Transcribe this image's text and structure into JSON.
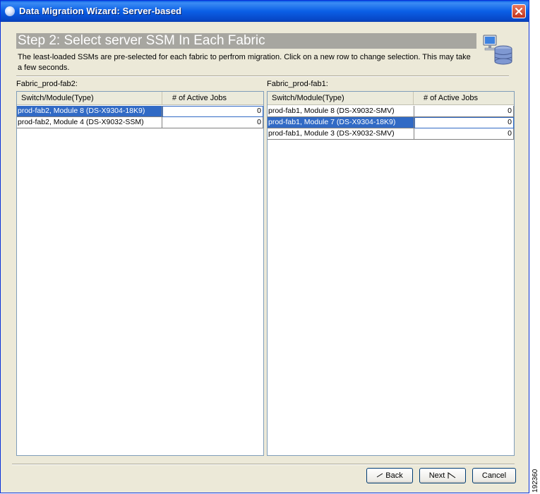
{
  "window": {
    "title": "Data Migration Wizard: Server-based"
  },
  "header": {
    "step_title": "Step 2: Select server SSM In Each Fabric",
    "description": "The least-loaded SSMs are pre-selected for each fabric to perfrom migration. Click on a new row to change selection. This may take a few seconds.",
    "icon": "server-database-icon"
  },
  "left": {
    "label": "Fabric_prod-fab2:",
    "columns": [
      "Switch/Module(Type)",
      "# of Active Jobs"
    ],
    "rows": [
      {
        "name": "prod-fab2, Module 8 (DS-X9304-18K9)",
        "jobs": "0",
        "selected": true
      },
      {
        "name": "prod-fab2, Module 4 (DS-X9032-SSM)",
        "jobs": "0",
        "selected": false
      }
    ]
  },
  "right": {
    "label": "Fabric_prod-fab1:",
    "columns": [
      "Switch/Module(Type)",
      "# of Active Jobs"
    ],
    "rows": [
      {
        "name": "prod-fab1, Module 8 (DS-X9032-SMV)",
        "jobs": "0",
        "selected": false
      },
      {
        "name": "prod-fab1, Module 7 (DS-X9304-18K9)",
        "jobs": "0",
        "selected": true
      },
      {
        "name": "prod-fab1, Module 3 (DS-X9032-SMV)",
        "jobs": "0",
        "selected": false
      }
    ]
  },
  "buttons": {
    "back": "Back",
    "next": "Next",
    "cancel": "Cancel"
  },
  "figure_code": "192360",
  "colors": {
    "selection": "#316ac5",
    "titlebar": "#0b5fe6",
    "header_band": "#a7a6a0"
  }
}
